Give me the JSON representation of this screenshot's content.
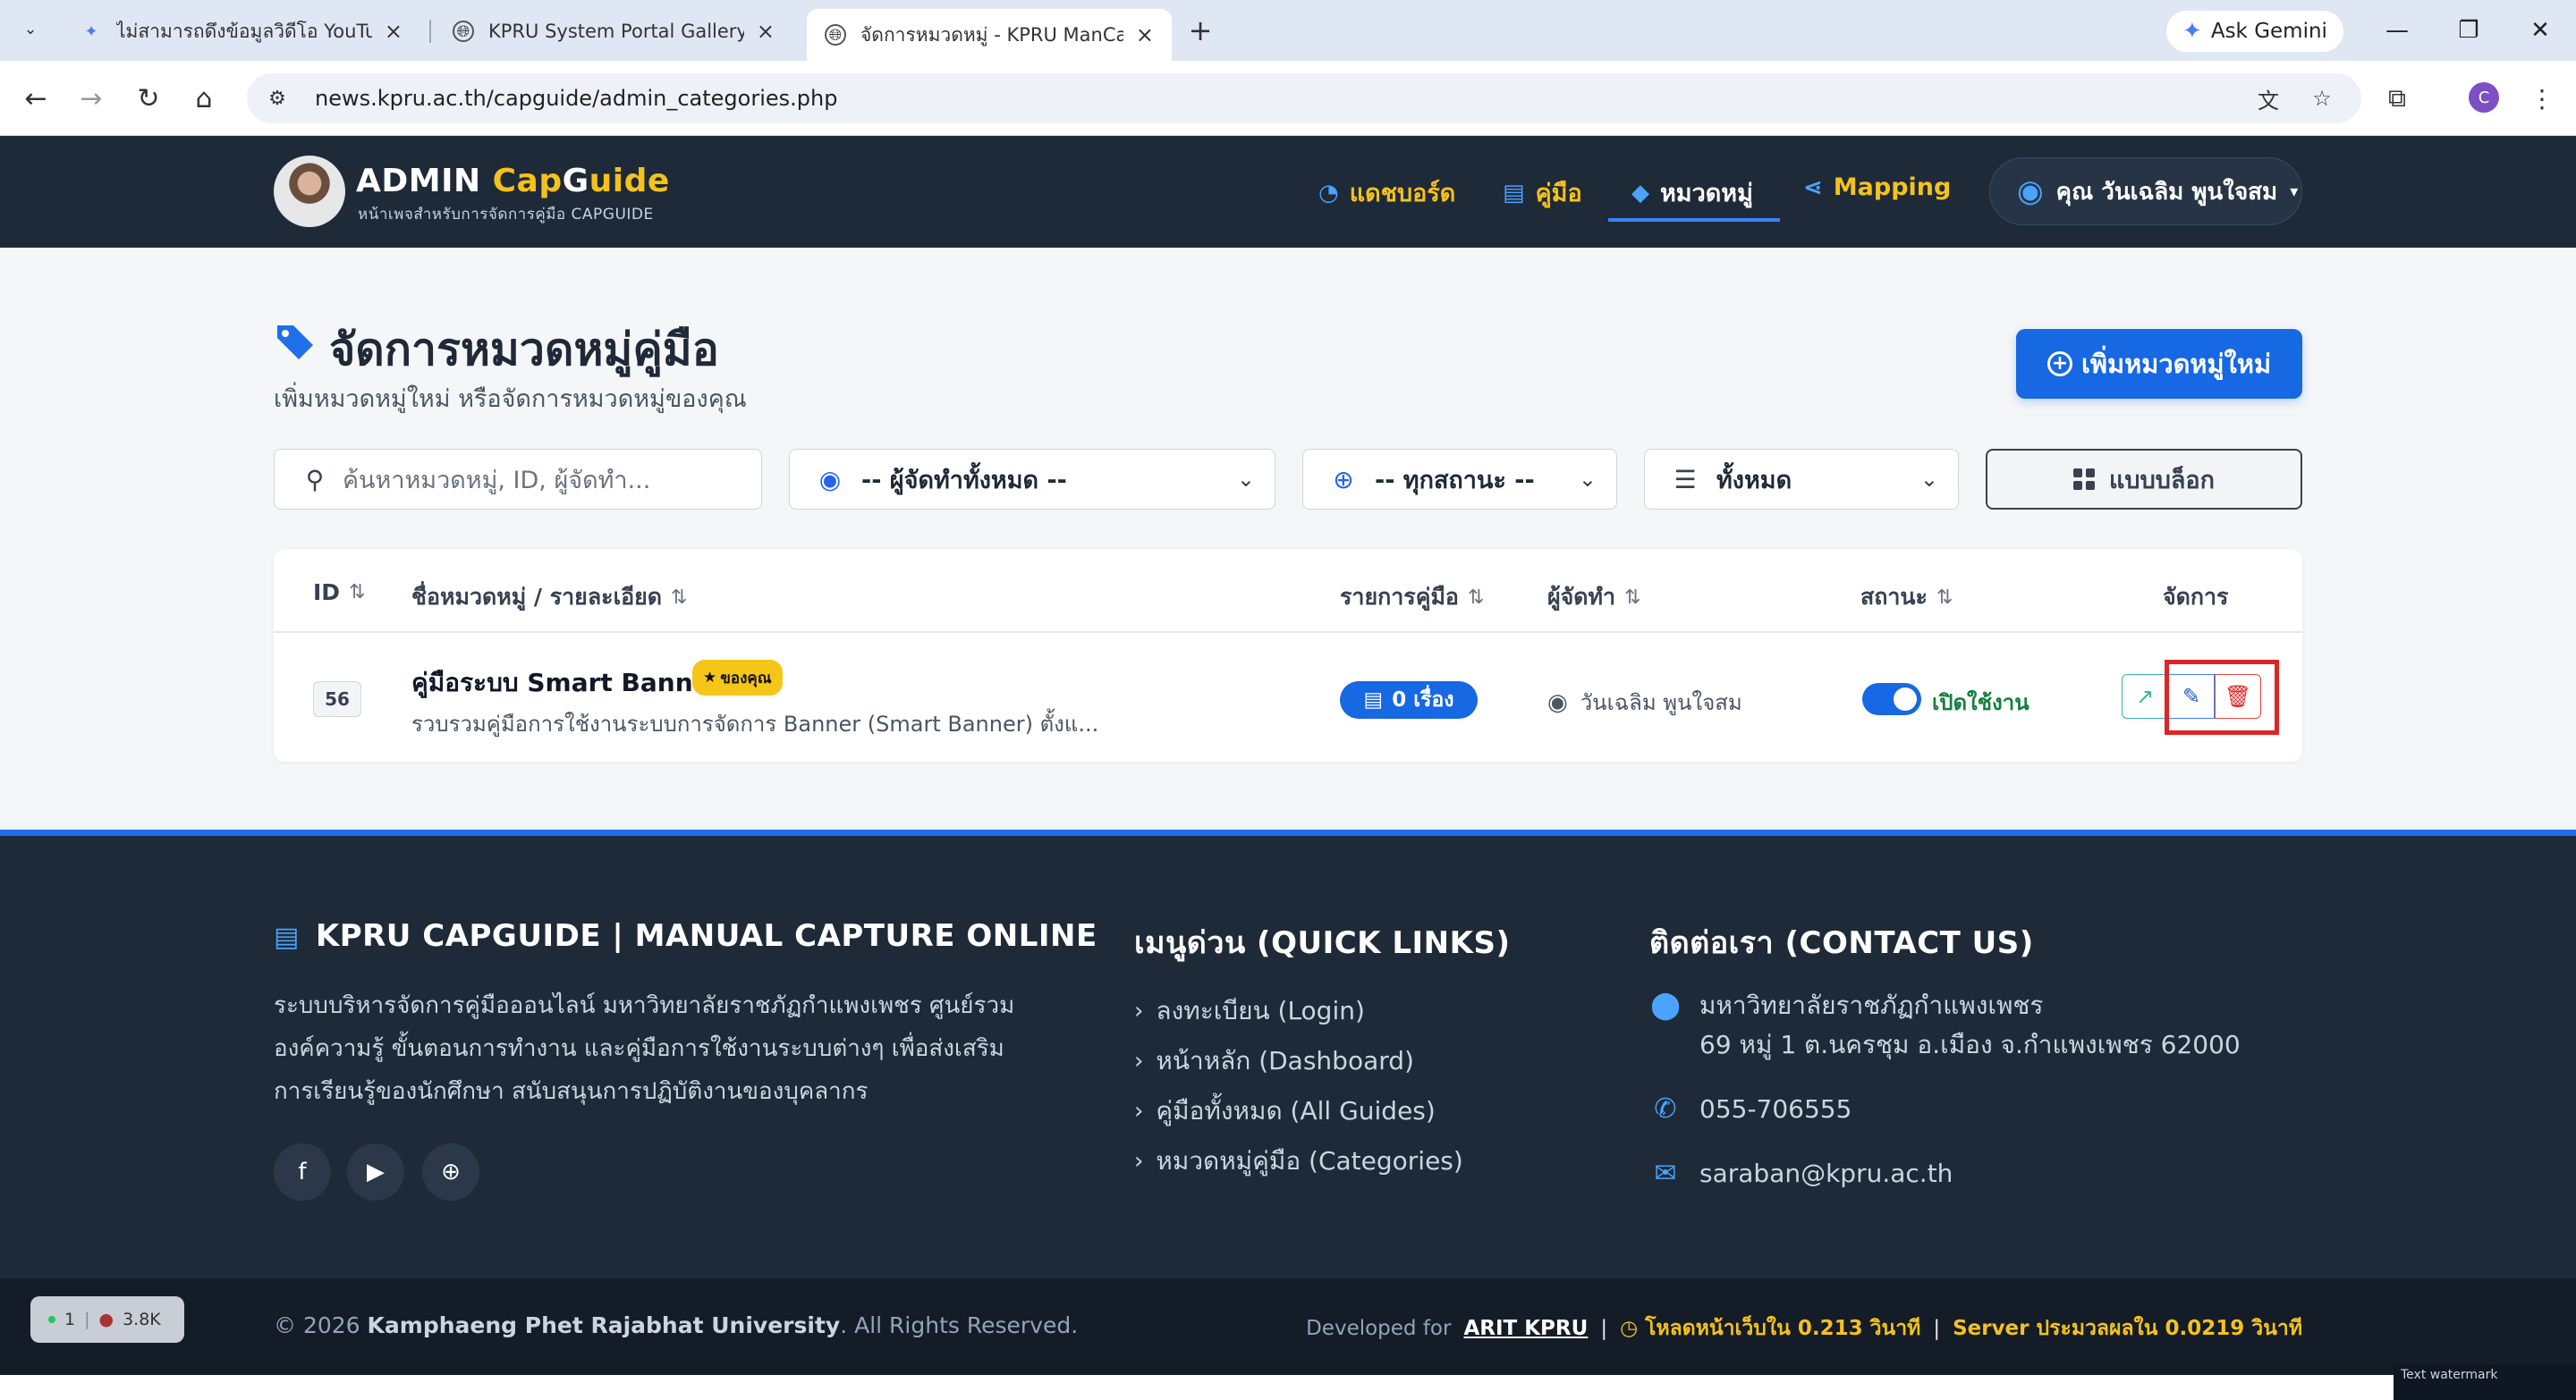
{
  "browser": {
    "tabs": [
      {
        "title": "ไม่สามารถดึงข้อมูลวิดีโอ YouTube",
        "icon": "gemini-icon",
        "active": false
      },
      {
        "title": "KPRU System Portal Gallery",
        "icon": "globe-icon",
        "active": false
      },
      {
        "title": "จัดการหมวดหมู่ - KPRU ManCap",
        "icon": "globe-icon",
        "active": true
      }
    ],
    "ask_gemini": "Ask Gemini",
    "url": "news.kpru.ac.th/capguide/admin_categories.php",
    "profile_initial": "C"
  },
  "nav": {
    "brand_prefix": "ADMIN ",
    "brand_hl1": "Cap",
    "brand_mid": "G",
    "brand_hl2": "uide",
    "brand_sub": "หน้าเพจสำหรับการจัดการคู่มือ CAPGUIDE",
    "links": [
      {
        "label": "แดชบอร์ด",
        "icon": "dashboard-icon"
      },
      {
        "label": "คู่มือ",
        "icon": "book-icon"
      },
      {
        "label": "หมวดหมู่",
        "icon": "tag-icon"
      },
      {
        "label": "Mapping",
        "icon": "share-icon"
      }
    ],
    "user": "คุณ วันเฉลิม พูนใจสม"
  },
  "main": {
    "title": "จัดการหมวดหมู่คู่มือ",
    "subtitle": "เพิ่มหมวดหมู่ใหม่ หรือจัดการหมวดหมู่ของคุณ",
    "add_button": "เพิ่มหมวดหมู่ใหม่",
    "search_placeholder": "ค้นหาหมวดหมู่, ID, ผู้จัดทำ...",
    "filter_owner": "-- ผู้จัดทำทั้งหมด --",
    "filter_status": "-- ทุกสถานะ --",
    "filter_count": "ทั้งหมด",
    "view_mode": "แบบบล็อก"
  },
  "table": {
    "columns": [
      "ID",
      "ชื่อหมวดหมู่ / รายละเอียด",
      "รายการคู่มือ",
      "ผู้จัดทำ",
      "สถานะ",
      "จัดการ"
    ],
    "rows": [
      {
        "id": "56",
        "name": "คู่มือระบบ Smart Banner",
        "badge": "ของคุณ",
        "desc": "รวบรวมคู่มือการใช้งานระบบการจัดการ Banner (Smart Banner) ตั้งแ...",
        "count": "0 เรื่อง",
        "owner": "วันเฉลิม พูนใจสม",
        "status": "เปิดใช้งาน",
        "status_on": true
      }
    ]
  },
  "footer": {
    "about_title": "KPRU CAPGUIDE | MANUAL CAPTURE ONLINE",
    "about_text": "ระบบบริหารจัดการคู่มือออนไลน์ มหาวิทยาลัยราชภัฏกำแพงเพชร ศูนย์รวมองค์ความรู้ ขั้นตอนการทำงาน และคู่มือการใช้งานระบบต่างๆ เพื่อส่งเสริมการเรียนรู้ของนักศึกษา สนับสนุนการปฏิบัติงานของบุคลากร",
    "quick_title": "เมนูด่วน (QUICK LINKS)",
    "quick_links": [
      "ลงทะเบียน (Login)",
      "หน้าหลัก (Dashboard)",
      "คู่มือทั้งหมด (All Guides)",
      "หมวดหมู่คู่มือ (Categories)"
    ],
    "contact_title": "ติดต่อเรา (CONTACT US)",
    "address_line1": "มหาวิทยาลัยราชภัฏกำแพงเพชร",
    "address_line2": "69 หมู่ 1 ต.นครชุม อ.เมือง จ.กำแพงเพชร 62000",
    "phone": "055-706555",
    "email": "saraban@kpru.ac.th",
    "copyright_pre": "© 2026 ",
    "copyright_org": "Kamphaeng Phet Rajabhat University",
    "copyright_post": ". All Rights Reserved.",
    "dev_label": "Developed for",
    "dev_link": "ARIT KPRU",
    "load_time": "โหลดหน้าเว็บใน 0.213 วินาที",
    "server_time": "Server ประมวลผลใน 0.0219 วินาที"
  },
  "widgets": {
    "online": "1",
    "views": "3.8K",
    "watermark": "Text watermark"
  },
  "colors": {
    "navy": "#1f2a38",
    "accent_yellow": "#f4c21b",
    "primary_blue": "#1668e3",
    "status_green": "#15803d",
    "highlight_red": "#dc2626"
  }
}
